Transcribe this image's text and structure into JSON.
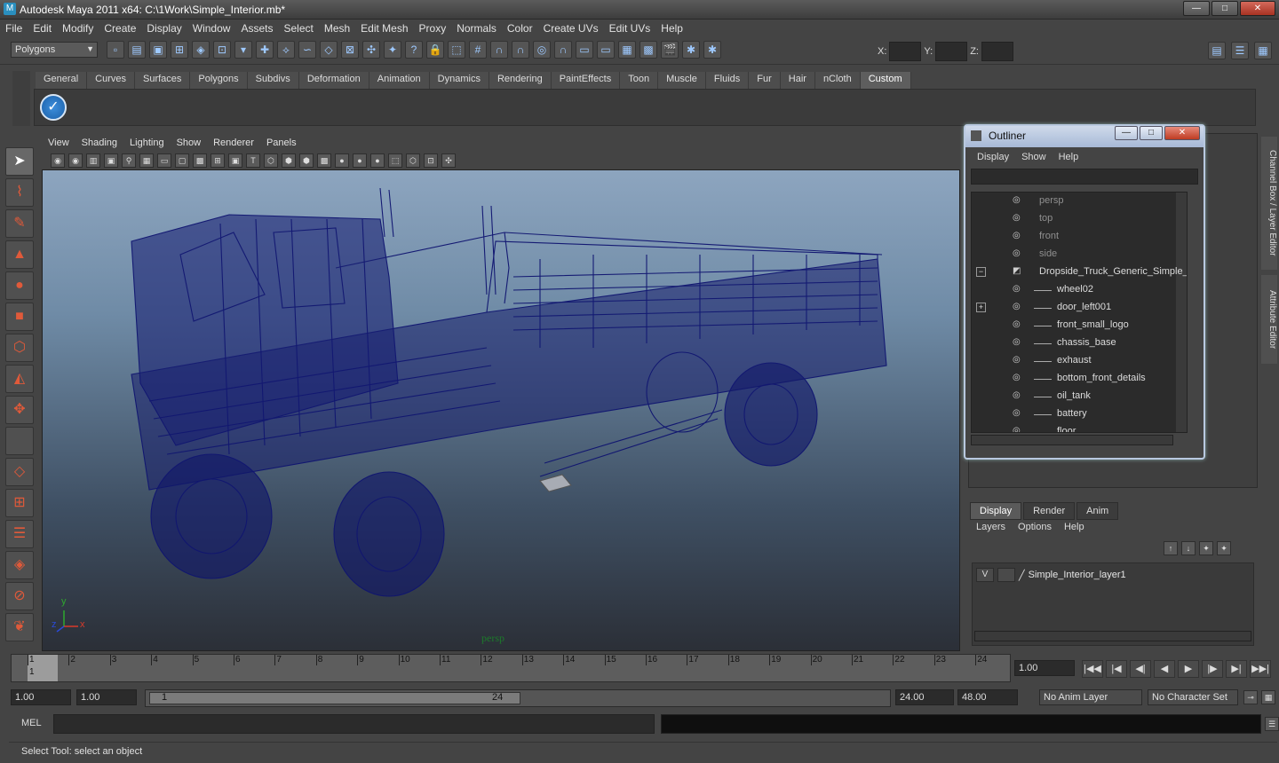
{
  "window": {
    "title": "Autodesk Maya 2011 x64: C:\\1Work\\Simple_Interior.mb*",
    "min": "—",
    "max": "□",
    "close": "✕"
  },
  "menubar": [
    "File",
    "Edit",
    "Modify",
    "Create",
    "Display",
    "Window",
    "Assets",
    "Select",
    "Mesh",
    "Edit Mesh",
    "Proxy",
    "Normals",
    "Color",
    "Create UVs",
    "Edit UVs",
    "Help"
  ],
  "status": {
    "mode": "Polygons",
    "x_label": "X:",
    "y_label": "Y:",
    "z_label": "Z:"
  },
  "shelf_tabs": [
    "General",
    "Curves",
    "Surfaces",
    "Polygons",
    "Subdivs",
    "Deformation",
    "Animation",
    "Dynamics",
    "Rendering",
    "PaintEffects",
    "Toon",
    "Muscle",
    "Fluids",
    "Fur",
    "Hair",
    "nCloth",
    "Custom"
  ],
  "shelf_active": "Custom",
  "panel_menu": [
    "View",
    "Shading",
    "Lighting",
    "Show",
    "Renderer",
    "Panels"
  ],
  "viewport": {
    "camera": "persp",
    "axis_y": "y",
    "axis_x": "x",
    "axis_z": "z",
    "wire_color": "#0f1470"
  },
  "outliner": {
    "title": "Outliner",
    "menu": [
      "Display",
      "Show",
      "Help"
    ],
    "items": [
      {
        "name": "persp",
        "kind": "camera"
      },
      {
        "name": "top",
        "kind": "camera"
      },
      {
        "name": "front",
        "kind": "camera"
      },
      {
        "name": "side",
        "kind": "camera"
      },
      {
        "name": "Dropside_Truck_Generic_Simple_Ir",
        "kind": "group",
        "expander": "−"
      },
      {
        "name": "wheel02",
        "kind": "child"
      },
      {
        "name": "door_left001",
        "kind": "child",
        "expander": "+"
      },
      {
        "name": "front_small_logo",
        "kind": "child"
      },
      {
        "name": "chassis_base",
        "kind": "child"
      },
      {
        "name": "exhaust",
        "kind": "child"
      },
      {
        "name": "bottom_front_details",
        "kind": "child"
      },
      {
        "name": "oil_tank",
        "kind": "child"
      },
      {
        "name": "battery",
        "kind": "child"
      },
      {
        "name": "floor",
        "kind": "child"
      }
    ]
  },
  "side_tabs": {
    "channel_box": "Channel Box / Layer Editor",
    "attribute_editor": "Attribute Editor"
  },
  "layer_editor": {
    "tabs": [
      "Display",
      "Render",
      "Anim"
    ],
    "menu": [
      "Layers",
      "Options",
      "Help"
    ],
    "layer": {
      "visible": "V",
      "name": "Simple_Interior_layer1"
    }
  },
  "timeline": {
    "ticks": [
      "1",
      "2",
      "3",
      "4",
      "5",
      "6",
      "7",
      "8",
      "9",
      "10",
      "11",
      "12",
      "13",
      "14",
      "15",
      "16",
      "17",
      "18",
      "19",
      "20",
      "21",
      "22",
      "23",
      "24"
    ],
    "current": "1",
    "current_field": "1.00"
  },
  "range": {
    "start": "1.00",
    "start_inner": "1.00",
    "handle_start": "1",
    "handle_end": "24",
    "end_inner": "24.00",
    "end": "48.00",
    "anim_layer": "No Anim Layer",
    "character_set": "No Character Set"
  },
  "command": {
    "label": "MEL"
  },
  "help_line": "Select Tool: select an object",
  "play_buttons": [
    "|◀◀",
    "|◀",
    "◀|",
    "◀",
    "▶",
    "|▶",
    "▶|",
    "▶▶|"
  ]
}
